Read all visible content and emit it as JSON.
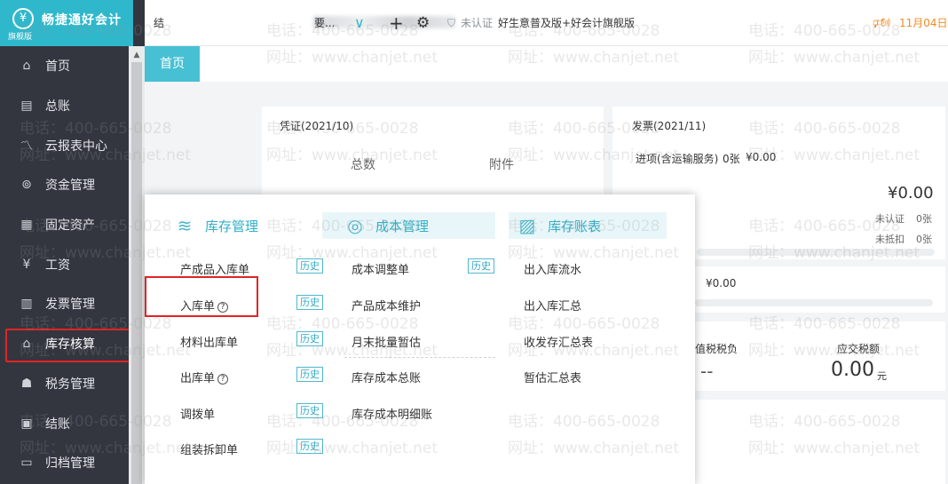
{
  "brand": {
    "logo_glyph": "¥",
    "name": "畅捷通好会计",
    "edition": "旗舰版"
  },
  "sidebar": {
    "items": [
      {
        "icon": "home-icon",
        "glyph": "⌂",
        "label": "首页"
      },
      {
        "icon": "ledger-icon",
        "glyph": "▤",
        "label": "总账"
      },
      {
        "icon": "chart-line-icon",
        "glyph": "〽",
        "label": "云报表中心"
      },
      {
        "icon": "wallet-icon",
        "glyph": "⊚",
        "label": "资金管理"
      },
      {
        "icon": "asset-icon",
        "glyph": "▦",
        "label": "固定资产"
      },
      {
        "icon": "salary-icon",
        "glyph": "¥",
        "label": "工资"
      },
      {
        "icon": "invoice-icon",
        "glyph": "▥",
        "label": "发票管理"
      },
      {
        "icon": "warehouse-icon",
        "glyph": "⌂",
        "label": "库存核算"
      },
      {
        "icon": "tax-icon",
        "glyph": "☗",
        "label": "税务管理"
      },
      {
        "icon": "close-period-icon",
        "glyph": "▣",
        "label": "结账"
      },
      {
        "icon": "archive-icon",
        "glyph": "▭",
        "label": "归档管理"
      }
    ],
    "active_index": 7,
    "scroll_up": "▲"
  },
  "topbar": {
    "company_prefix": "结",
    "company_suffix": "要...",
    "chevron": "∨",
    "add": "+",
    "settings": "⚙",
    "shield": "⛉",
    "uncertified": "未认证",
    "edition_info": "好生意普及版+好会计旗舰版",
    "speaker": "🕬",
    "date_notice": "11月04日"
  },
  "tabs": {
    "home": "首页"
  },
  "voucher": {
    "title": "凭证(2021/10)",
    "total_label": "总数",
    "attach_label": "附件"
  },
  "invoice": {
    "title": "发票(2021/11)",
    "input_label": "进项(含运输服务)",
    "input_count": "0张",
    "input_amount": "¥0.00",
    "amount_left": "¥0.00",
    "amount_right": "¥0.00",
    "zhang1": "张",
    "zhang2": "张",
    "uncertified_label": "未认证",
    "uncertified_count": "0张",
    "undeducted_label": "未抵扣",
    "undeducted_count": "0张",
    "row3_amount": "¥0.00"
  },
  "tax": {
    "vat_label": "值税税负",
    "vat_value": "--",
    "due_label": "应交税额",
    "due_value": "0.00",
    "due_unit": "元"
  },
  "popup": {
    "inventory": {
      "title": "库存管理",
      "icon": "≋",
      "items": [
        {
          "label": "产成品入库单",
          "hist": "历史",
          "help": ""
        },
        {
          "label": "入库单",
          "hist": "历史",
          "help": "?"
        },
        {
          "label": "材料出库单",
          "hist": "历史",
          "help": ""
        },
        {
          "label": "出库单",
          "hist": "历史",
          "help": "?"
        },
        {
          "label": "调拨单",
          "hist": "历史",
          "help": ""
        },
        {
          "label": "组装拆卸单",
          "hist": "历史",
          "help": ""
        }
      ]
    },
    "cost": {
      "title": "成本管理",
      "icon": "◎",
      "items": [
        {
          "label": "成本调整单",
          "hist": "历史"
        },
        {
          "label": "产品成本维护"
        },
        {
          "label": "月末批量暂估"
        },
        {
          "label": "库存成本总账"
        },
        {
          "label": "库存成本明细账"
        }
      ]
    },
    "report": {
      "title": "库存账表",
      "icon": "▨",
      "items": [
        {
          "label": "出入库流水"
        },
        {
          "label": "出入库汇总"
        },
        {
          "label": "收发存汇总表"
        },
        {
          "label": "暂估汇总表"
        }
      ]
    }
  },
  "watermark": {
    "phone": "电话：400-665-0028",
    "site": "网址：www.chanjet.net"
  },
  "colors": {
    "accent": "#2fb8cc",
    "sidebar_bg": "#33363f",
    "highlight": "#e02424"
  }
}
